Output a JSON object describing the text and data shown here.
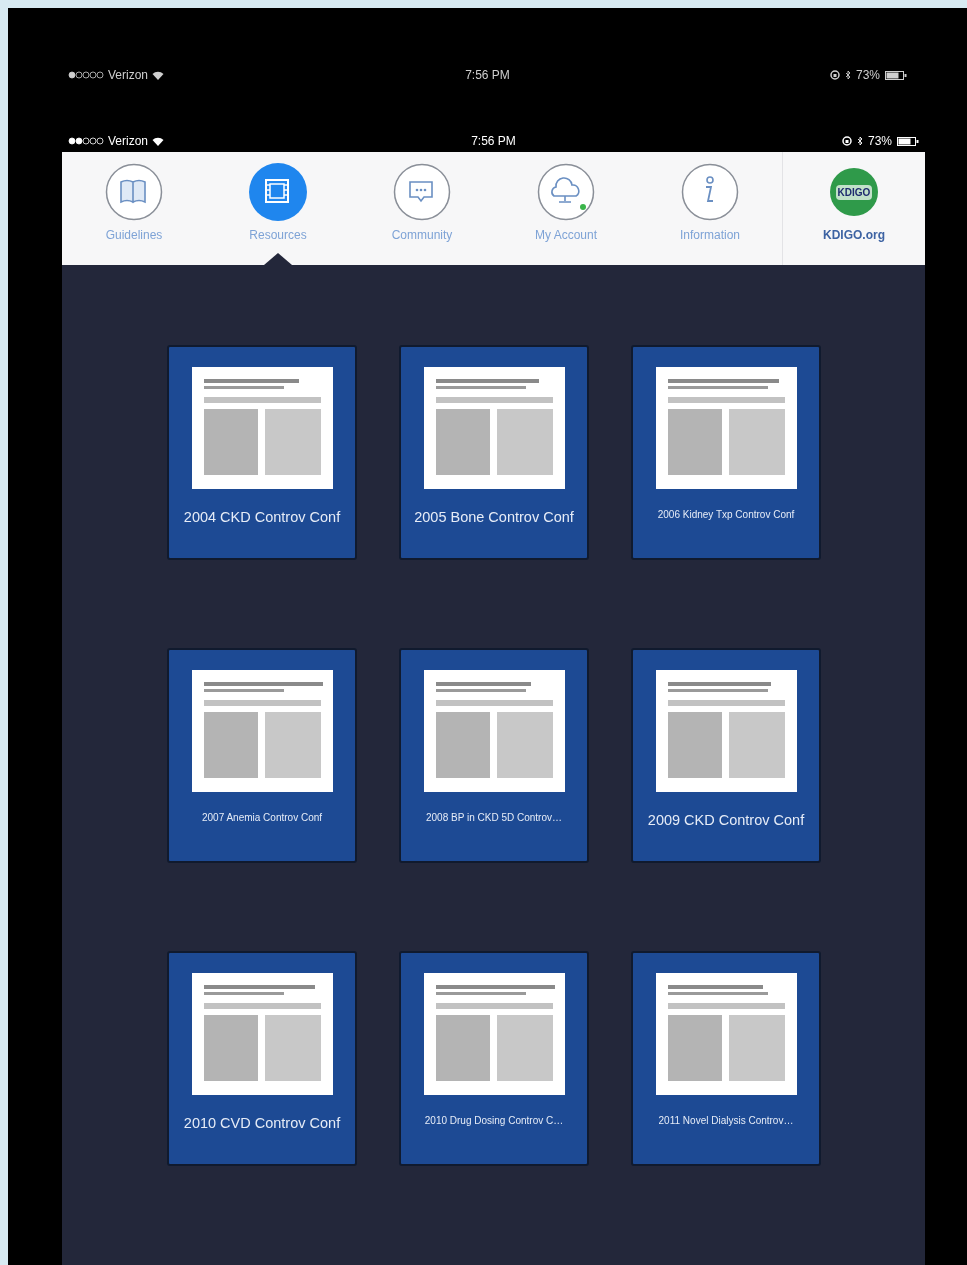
{
  "outer_status_bar": {
    "carrier": "Verizon",
    "time": "7:56 PM",
    "battery": "73%"
  },
  "status_bar": {
    "carrier": "Verizon",
    "time": "7:56 PM",
    "battery": "73%"
  },
  "tabs": [
    {
      "kind": "book",
      "label": "Guidelines",
      "selected": false
    },
    {
      "kind": "film",
      "label": "Resources",
      "selected": true
    },
    {
      "kind": "chat",
      "label": "Community",
      "selected": false
    },
    {
      "kind": "cloud",
      "label": "My Account",
      "selected": false
    },
    {
      "kind": "info",
      "label": "Information",
      "selected": false
    },
    {
      "kind": "logo",
      "label": "KDIGO.org",
      "logo_text": "KDIGO",
      "selected": false
    }
  ],
  "documents": [
    {
      "title": "2004 CKD Controv Conf"
    },
    {
      "title": "2005 Bone Controv Conf"
    },
    {
      "title": "2006 Kidney Txp Controv Conf"
    },
    {
      "title": "2007 Anemia Controv Conf"
    },
    {
      "title": "2008 BP in CKD 5D Controv…"
    },
    {
      "title": "2009 CKD Controv Conf"
    },
    {
      "title": "2010 CVD Controv Conf"
    },
    {
      "title": "2010 Drug Dosing Controv C…"
    },
    {
      "title": "2011 Novel Dialysis Controv…"
    }
  ]
}
